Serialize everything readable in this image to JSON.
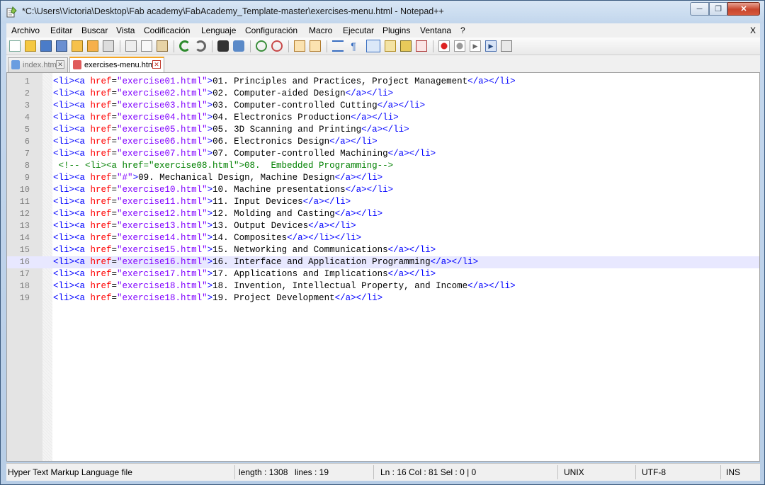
{
  "window": {
    "title": "*C:\\Users\\Victoria\\Desktop\\Fab academy\\FabAcademy_Template-master\\exercises-menu.html - Notepad++"
  },
  "menu": {
    "items": [
      "Archivo",
      "Editar",
      "Buscar",
      "Vista",
      "Codificación",
      "Lenguaje",
      "Configuración",
      "Macro",
      "Ejecutar",
      "Plugins",
      "Ventana",
      "?"
    ],
    "close": "X"
  },
  "tabs": [
    {
      "label": "index.html",
      "active": false
    },
    {
      "label": "exercises-menu.html",
      "active": true
    }
  ],
  "editor": {
    "current_line": 16,
    "lines": [
      {
        "n": "1",
        "href": "exercise01.html",
        "text": "01. Principles and Practices, Project Management",
        "close": "</a></li>"
      },
      {
        "n": "2",
        "href": "exercise02.html",
        "text": "02. Computer-aided Design",
        "close": "</a></li>"
      },
      {
        "n": "3",
        "href": "exercise03.html",
        "text": "03. Computer-controlled Cutting",
        "close": "</a></li>"
      },
      {
        "n": "4",
        "href": "exercise04.html",
        "text": "04. Electronics Production",
        "close": "</a></li>"
      },
      {
        "n": "5",
        "href": "exercise05.html",
        "text": "05. 3D Scanning and Printing",
        "close": "</a></li>"
      },
      {
        "n": "6",
        "href": "exercise06.html",
        "text": "06. Electronics Design",
        "close": "</a></li>"
      },
      {
        "n": "7",
        "href": "exercise07.html",
        "text": "07. Computer-controlled Machining",
        "close": "</a></li>"
      },
      {
        "n": "8",
        "comment": " <!-- <li><a href=\"exercise08.html\">08.  Embedded Programming-->"
      },
      {
        "n": "9",
        "href": "#",
        "text": "09. Mechanical Design, Machine Design",
        "close": "</a></li>"
      },
      {
        "n": "10",
        "href": "exercise10.html",
        "text": "10. Machine presentations",
        "close": "</a></li>"
      },
      {
        "n": "11",
        "href": "exercise11.html",
        "text": "11. Input Devices",
        "close": "</a></li>"
      },
      {
        "n": "12",
        "href": "exercise12.html",
        "text": "12. Molding and Casting",
        "close": "</a></li>"
      },
      {
        "n": "13",
        "href": "exercise13.html",
        "text": "13. Output Devices",
        "close": "</a></li>"
      },
      {
        "n": "14",
        "href": "exercise14.html",
        "text": "14. Composites",
        "close": "</a></li></li>"
      },
      {
        "n": "15",
        "href": "exercise15.html",
        "text": "15. Networking and Communications",
        "close": "</a></li>"
      },
      {
        "n": "16",
        "href": "exercise16.html",
        "text": "16. Interface and Application Programming",
        "close": "</a></li>"
      },
      {
        "n": "17",
        "href": "exercise17.html",
        "text": "17. Applications and Implications",
        "close": "</a></li>"
      },
      {
        "n": "18",
        "href": "exercise18.html",
        "text": "18. Invention, Intellectual Property, and Income",
        "close": "</a></li>"
      },
      {
        "n": "19",
        "href": "exercise18.html",
        "text": "19. Project Development",
        "close": "</a></li>"
      }
    ]
  },
  "status": {
    "file_type": "Hyper Text Markup Language file",
    "length": "length : 1308",
    "lines": "lines : 19",
    "position": "Ln : 16    Col : 81    Sel : 0 | 0",
    "eol": "UNIX",
    "encoding": "UTF-8",
    "mode": "INS"
  },
  "toolbar": {
    "icons": [
      "new-file-icon",
      "open-file-icon",
      "save-icon",
      "save-all-icon",
      "close-icon",
      "close-all-icon",
      "print-icon",
      "cut-icon",
      "copy-icon",
      "paste-icon",
      "undo-icon",
      "redo-icon",
      "find-icon",
      "replace-icon",
      "zoom-in-icon",
      "zoom-out-icon",
      "sync-vertical-icon",
      "sync-horizontal-icon",
      "word-wrap-icon",
      "show-all-chars-icon",
      "indent-guide-icon",
      "user-language-icon",
      "doc-map-icon",
      "function-list-icon",
      "record-macro-icon",
      "stop-macro-icon",
      "play-macro-icon",
      "run-macro-multiple-icon",
      "save-macro-icon"
    ]
  }
}
